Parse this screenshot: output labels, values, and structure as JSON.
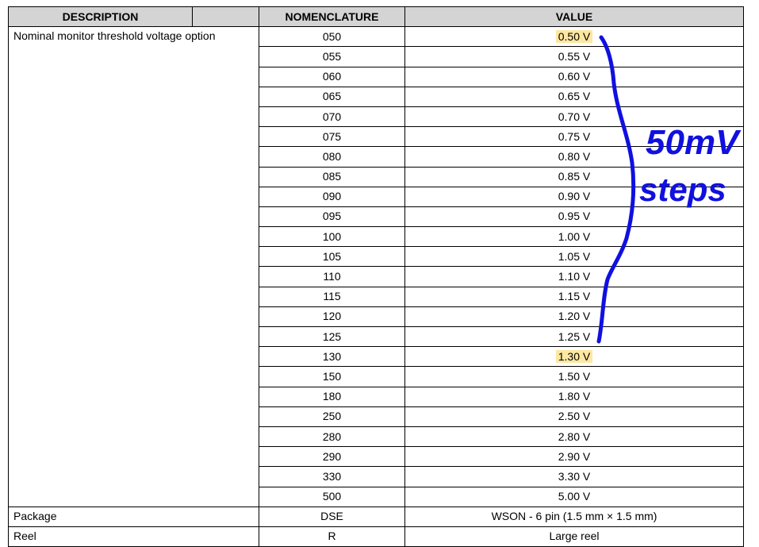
{
  "header": {
    "description": "DESCRIPTION",
    "nomenclature": "NOMENCLATURE",
    "value": "VALUE"
  },
  "threshold": {
    "description": "Nominal monitor threshold voltage option",
    "rows": [
      {
        "nom": "050",
        "value": "0.50 V",
        "highlight": true
      },
      {
        "nom": "055",
        "value": "0.55 V"
      },
      {
        "nom": "060",
        "value": "0.60 V"
      },
      {
        "nom": "065",
        "value": "0.65 V"
      },
      {
        "nom": "070",
        "value": "0.70 V"
      },
      {
        "nom": "075",
        "value": "0.75 V"
      },
      {
        "nom": "080",
        "value": "0.80 V"
      },
      {
        "nom": "085",
        "value": "0.85 V"
      },
      {
        "nom": "090",
        "value": "0.90 V"
      },
      {
        "nom": "095",
        "value": "0.95 V"
      },
      {
        "nom": "100",
        "value": "1.00 V"
      },
      {
        "nom": "105",
        "value": "1.05 V"
      },
      {
        "nom": "110",
        "value": "1.10 V"
      },
      {
        "nom": "115",
        "value": "1.15 V"
      },
      {
        "nom": "120",
        "value": "1.20 V"
      },
      {
        "nom": "125",
        "value": "1.25 V"
      },
      {
        "nom": "130",
        "value": "1.30 V",
        "highlight": true
      },
      {
        "nom": "150",
        "value": "1.50 V"
      },
      {
        "nom": "180",
        "value": "1.80 V"
      },
      {
        "nom": "250",
        "value": "2.50 V"
      },
      {
        "nom": "280",
        "value": "2.80 V"
      },
      {
        "nom": "290",
        "value": "2.90 V"
      },
      {
        "nom": "330",
        "value": "3.30 V"
      },
      {
        "nom": "500",
        "value": "5.00 V"
      }
    ]
  },
  "package": {
    "description": "Package",
    "nom": "DSE",
    "value": "WSON - 6 pin (1.5 mm × 1.5 mm)"
  },
  "reel": {
    "description": "Reel",
    "nom": "R",
    "value": "Large reel"
  },
  "annotation": {
    "line1": "50mV",
    "line2": "steps",
    "color": "#1010e0"
  },
  "colors": {
    "header_bg": "#d4d4d4",
    "highlight": "#fde7a1"
  }
}
